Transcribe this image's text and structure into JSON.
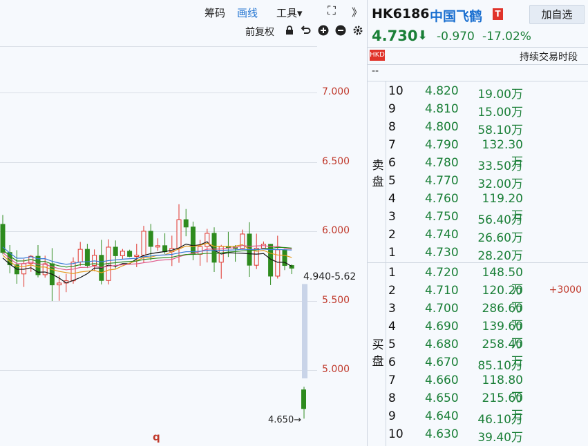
{
  "toolbar": {
    "chip_label": "筹码",
    "draw_label": "画线",
    "tools_label": "工具▾",
    "adjust_label": "前复权",
    "expand_glyph": "⛶",
    "more_glyph": "》"
  },
  "chart": {
    "price_levels": [
      "7.000",
      "6.500",
      "6.000",
      "5.500",
      "5.000"
    ],
    "range_label": "4.940-5.62",
    "low_label": "4.650→",
    "bottom_marker": "q",
    "colors": {
      "up": "#e0332a",
      "down": "#2e8b1e",
      "ma_black": "#111111",
      "ma_green": "#2e8b1e",
      "ma_orange": "#e59a1c",
      "ma_pink": "#e05a8a",
      "ma_blue": "#3b7bd6"
    }
  },
  "quote": {
    "code": "HK6186",
    "name": "中国飞鹤",
    "tag": "T",
    "watch_button": "加自选",
    "price": "4.730",
    "arrow": "⬇",
    "change": "-0.970",
    "change_pct": "-17.02%",
    "market_badge": "HKD",
    "session_label": "持续交易时段",
    "placeholder": "--"
  },
  "orderbook": {
    "ask_label": "卖盘",
    "bid_label": "买盘",
    "asks": [
      {
        "level": "10",
        "price": "4.820",
        "volume": "19.00万"
      },
      {
        "level": "9",
        "price": "4.810",
        "volume": "15.00万"
      },
      {
        "level": "8",
        "price": "4.800",
        "volume": "58.10万"
      },
      {
        "level": "7",
        "price": "4.790",
        "volume": "132.30万"
      },
      {
        "level": "6",
        "price": "4.780",
        "volume": "33.50万"
      },
      {
        "level": "5",
        "price": "4.770",
        "volume": "32.00万"
      },
      {
        "level": "4",
        "price": "4.760",
        "volume": "119.20万"
      },
      {
        "level": "3",
        "price": "4.750",
        "volume": "56.40万"
      },
      {
        "level": "2",
        "price": "4.740",
        "volume": "26.60万"
      },
      {
        "level": "1",
        "price": "4.730",
        "volume": "28.20万"
      }
    ],
    "bids": [
      {
        "level": "1",
        "price": "4.720",
        "volume": "148.50万",
        "change": ""
      },
      {
        "level": "2",
        "price": "4.710",
        "volume": "120.20万",
        "change": "+3000"
      },
      {
        "level": "3",
        "price": "4.700",
        "volume": "286.60万",
        "change": ""
      },
      {
        "level": "4",
        "price": "4.690",
        "volume": "139.60万",
        "change": ""
      },
      {
        "level": "5",
        "price": "4.680",
        "volume": "258.40万",
        "change": ""
      },
      {
        "level": "6",
        "price": "4.670",
        "volume": "85.10万",
        "change": ""
      },
      {
        "level": "7",
        "price": "4.660",
        "volume": "118.80万",
        "change": ""
      },
      {
        "level": "8",
        "price": "4.650",
        "volume": "215.60万",
        "change": ""
      },
      {
        "level": "9",
        "price": "4.640",
        "volume": "46.10万",
        "change": ""
      },
      {
        "level": "10",
        "price": "4.630",
        "volume": "39.40万",
        "change": ""
      }
    ]
  }
}
